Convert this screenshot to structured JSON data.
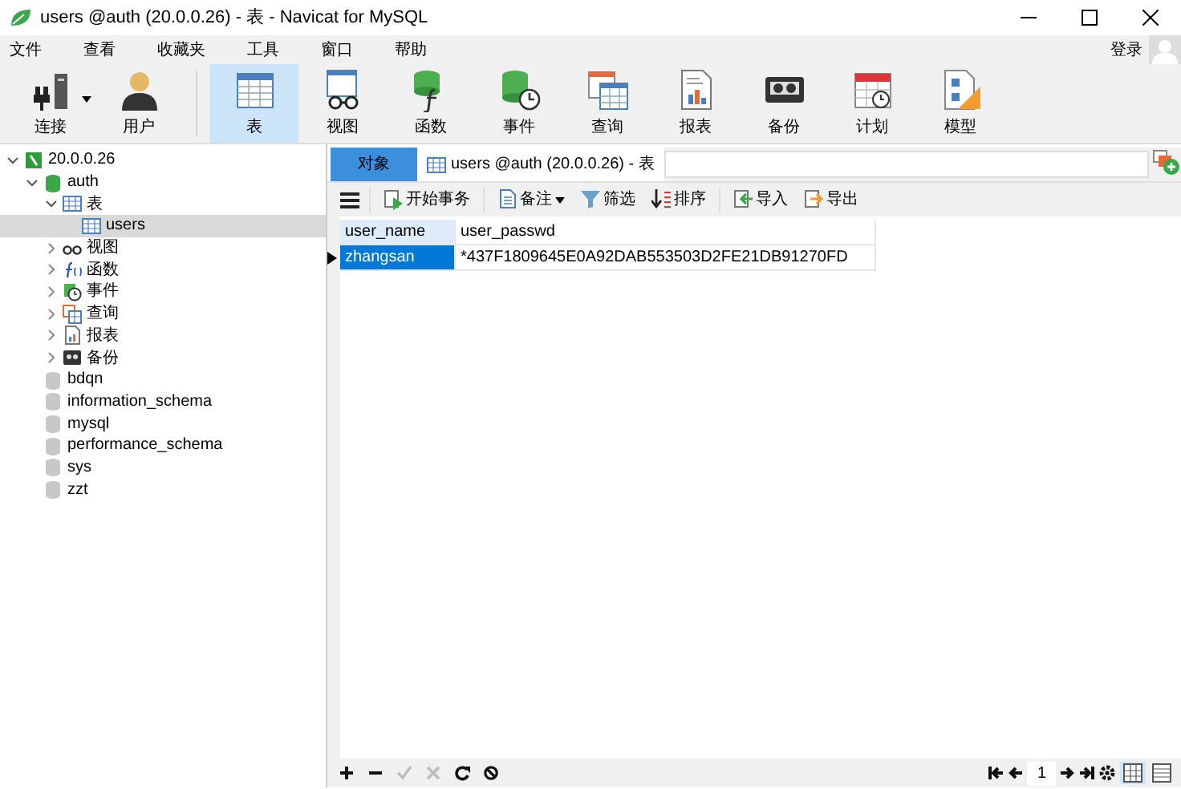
{
  "window": {
    "title": "users @auth (20.0.0.26) - 表 - Navicat for MySQL"
  },
  "menu": [
    "文件",
    "查看",
    "收藏夹",
    "工具",
    "窗口",
    "帮助"
  ],
  "login": "登录",
  "toolbar": [
    {
      "kind": "connection",
      "label": "连接",
      "selected": false,
      "dropdown": true
    },
    {
      "kind": "user",
      "label": "用户",
      "selected": false
    },
    {
      "kind": "table",
      "label": "表",
      "selected": true
    },
    {
      "kind": "view",
      "label": "视图",
      "selected": false
    },
    {
      "kind": "function",
      "label": "函数",
      "selected": false
    },
    {
      "kind": "event",
      "label": "事件",
      "selected": false
    },
    {
      "kind": "query",
      "label": "查询",
      "selected": false
    },
    {
      "kind": "report",
      "label": "报表",
      "selected": false
    },
    {
      "kind": "backup",
      "label": "备份",
      "selected": false
    },
    {
      "kind": "schedule",
      "label": "计划",
      "selected": false
    },
    {
      "kind": "model",
      "label": "模型",
      "selected": false
    }
  ],
  "tree": [
    {
      "kind": "connection",
      "label": "20.0.0.26",
      "expanded": true,
      "selected": false,
      "children": [
        {
          "kind": "database",
          "label": "auth",
          "expanded": true,
          "selected": false,
          "active": true,
          "children": [
            {
              "kind": "table",
              "label": "表",
              "expanded": true,
              "selected": false,
              "children": [
                {
                  "kind": "table",
                  "label": "users",
                  "selected": true
                }
              ]
            },
            {
              "kind": "view",
              "label": "视图",
              "expanded": false,
              "selected": false
            },
            {
              "kind": "function",
              "label": "函数",
              "expanded": false,
              "selected": false
            },
            {
              "kind": "event",
              "label": "事件",
              "expanded": false,
              "selected": false
            },
            {
              "kind": "query",
              "label": "查询",
              "expanded": false,
              "selected": false
            },
            {
              "kind": "report",
              "label": "报表",
              "expanded": false,
              "selected": false
            },
            {
              "kind": "backup",
              "label": "备份",
              "expanded": false,
              "selected": false
            }
          ]
        },
        {
          "kind": "database",
          "label": "bdqn",
          "selected": false,
          "active": false
        },
        {
          "kind": "database",
          "label": "information_schema",
          "selected": false,
          "active": false
        },
        {
          "kind": "database",
          "label": "mysql",
          "selected": false,
          "active": false
        },
        {
          "kind": "database",
          "label": "performance_schema",
          "selected": false,
          "active": false
        },
        {
          "kind": "database",
          "label": "sys",
          "selected": false,
          "active": false
        },
        {
          "kind": "database",
          "label": "zzt",
          "selected": false,
          "active": false
        }
      ]
    }
  ],
  "tabs": [
    {
      "label": "对象",
      "selected": false
    },
    {
      "label": "users @auth (20.0.0.26) - 表",
      "selected": true
    }
  ],
  "grid_toolbar": [
    {
      "kind": "menu"
    },
    {
      "kind": "transaction",
      "label": "开始事务"
    },
    {
      "kind": "note",
      "label": "备注",
      "dropdown": true
    },
    {
      "kind": "filter",
      "label": "筛选"
    },
    {
      "kind": "sort",
      "label": "排序"
    },
    {
      "kind": "import",
      "label": "导入"
    },
    {
      "kind": "export",
      "label": "导出"
    }
  ],
  "table": {
    "columns": [
      {
        "label": "user_name",
        "selected": true
      },
      {
        "label": "user_passwd",
        "selected": false
      }
    ],
    "rows": [
      {
        "selected": true,
        "cells": [
          "zhangsan",
          "*437F1809645E0A92DAB553503D2FE21DB91270FD"
        ]
      }
    ]
  },
  "bottom_bar": {
    "left": [
      {
        "kind": "add",
        "disabled": false
      },
      {
        "kind": "remove",
        "disabled": false
      },
      {
        "kind": "apply",
        "disabled": true
      },
      {
        "kind": "cancel",
        "disabled": true
      },
      {
        "kind": "refresh",
        "disabled": false
      },
      {
        "kind": "stop",
        "disabled": false
      }
    ],
    "page": "1",
    "views": [
      {
        "kind": "grid",
        "selected": true
      },
      {
        "kind": "form",
        "selected": false
      }
    ]
  }
}
